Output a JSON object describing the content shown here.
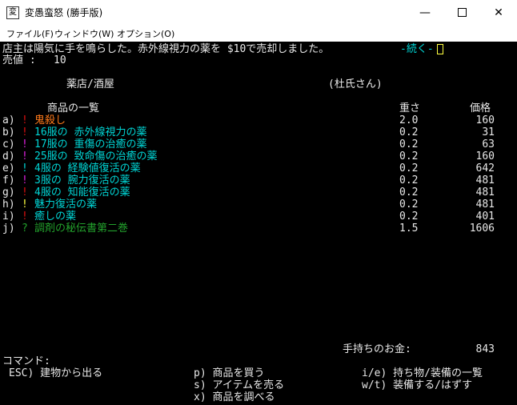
{
  "window": {
    "title": "変愚蛮怒 (勝手版)",
    "controls": {
      "minimize": "—",
      "close": "✕"
    }
  },
  "menu": {
    "file": "ファイル(F)",
    "window": "ウィンドウ(W)",
    "options": "オプション(O)"
  },
  "message": {
    "text": "店主は陽気に手を鳴らした。赤外線視力の薬を $10で売却しました。",
    "more": "-続く-",
    "sale_label": "売値 :",
    "sale_value": "10"
  },
  "store": {
    "name": "薬店/酒屋",
    "owner": "(杜氏さん)",
    "list_title": "商品の一覧",
    "col_weight": "重さ",
    "col_price": "価格"
  },
  "items": [
    {
      "key": "a)",
      "mark": "!",
      "name": "鬼殺し",
      "weight": "2.0",
      "price": "160",
      "mark_color": "#e01010",
      "name_color": "#ff7a1a"
    },
    {
      "key": "b)",
      "mark": "!",
      "name": "16服の 赤外線視力の薬",
      "weight": "0.2",
      "price": "31",
      "mark_color": "#e01010",
      "name_color": "#00d4d4"
    },
    {
      "key": "c)",
      "mark": "!",
      "name": "17服の 重傷の治癒の薬",
      "weight": "0.2",
      "price": "63",
      "mark_color": "#e020e0",
      "name_color": "#00d4d4"
    },
    {
      "key": "d)",
      "mark": "!",
      "name": "25服の 致命傷の治癒の薬",
      "weight": "0.2",
      "price": "160",
      "mark_color": "#e020e0",
      "name_color": "#00d4d4"
    },
    {
      "key": "e)",
      "mark": "!",
      "name": "4服の 経験値復活の薬",
      "weight": "0.2",
      "price": "642",
      "mark_color": "#00d4d4",
      "name_color": "#00d4d4"
    },
    {
      "key": "f)",
      "mark": "!",
      "name": "3服の 腕力復活の薬",
      "weight": "0.2",
      "price": "481",
      "mark_color": "#e020e0",
      "name_color": "#00d4d4"
    },
    {
      "key": "g)",
      "mark": "!",
      "name": "4服の 知能復活の薬",
      "weight": "0.2",
      "price": "481",
      "mark_color": "#e01010",
      "name_color": "#00d4d4"
    },
    {
      "key": "h)",
      "mark": "!",
      "name": "魅力復活の薬",
      "weight": "0.2",
      "price": "481",
      "mark_color": "#ffff40",
      "name_color": "#00d4d4"
    },
    {
      "key": "i)",
      "mark": "!",
      "name": "癒しの薬",
      "weight": "0.2",
      "price": "401",
      "mark_color": "#e01010",
      "name_color": "#00d4d4"
    },
    {
      "key": "j)",
      "mark": "?",
      "name": "調剤の秘伝書第二巻",
      "weight": "1.5",
      "price": "1606",
      "mark_color": "#22a02c",
      "name_color": "#22a02c"
    }
  ],
  "gold": {
    "label": "手持ちのお金:",
    "value": "843"
  },
  "commands": {
    "title": "コマンド:",
    "exit": "ESC) 建物から出る",
    "buy": "p) 商品を買う",
    "sell": "s) アイテムを売る",
    "examine": "x) 商品を調べる",
    "inventory": "i/e) 持ち物/装備の一覧",
    "wear": "w/t) 装備する/はずす"
  },
  "colors": {
    "background": "#000000",
    "text": "#e8e8e8",
    "cyan": "#00d4d4",
    "orange": "#ff7a1a",
    "red": "#e01010",
    "magenta": "#e020e0",
    "yellow": "#ffff40",
    "green": "#22a02c"
  }
}
